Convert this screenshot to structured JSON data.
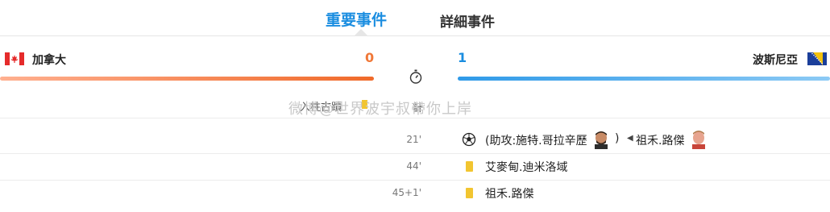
{
  "tabs": {
    "key_events": "重要事件",
    "detailed_events": "詳細事件"
  },
  "match": {
    "home": {
      "name": "加拿大",
      "score": "0"
    },
    "away": {
      "name": "波斯尼亞",
      "score": "1"
    }
  },
  "legend": {
    "text": "入柱古蹟",
    "clock": "計"
  },
  "watermark": "微博@世界波宇叔帶你上岸",
  "events": [
    {
      "minute": "21'",
      "type": "goal",
      "text": "(助攻:施特.哥拉辛歷",
      "close": ")",
      "sub_player": "祖禾.路傑"
    },
    {
      "minute": "44'",
      "type": "yellow-card",
      "text": "艾麥甸.迪米洛域"
    },
    {
      "minute": "45+1'",
      "type": "yellow-card",
      "text": "祖禾.路傑"
    }
  ],
  "colors": {
    "accent": "#1a8de0",
    "home": "#f07838",
    "yellow_card": "#f2c530"
  }
}
